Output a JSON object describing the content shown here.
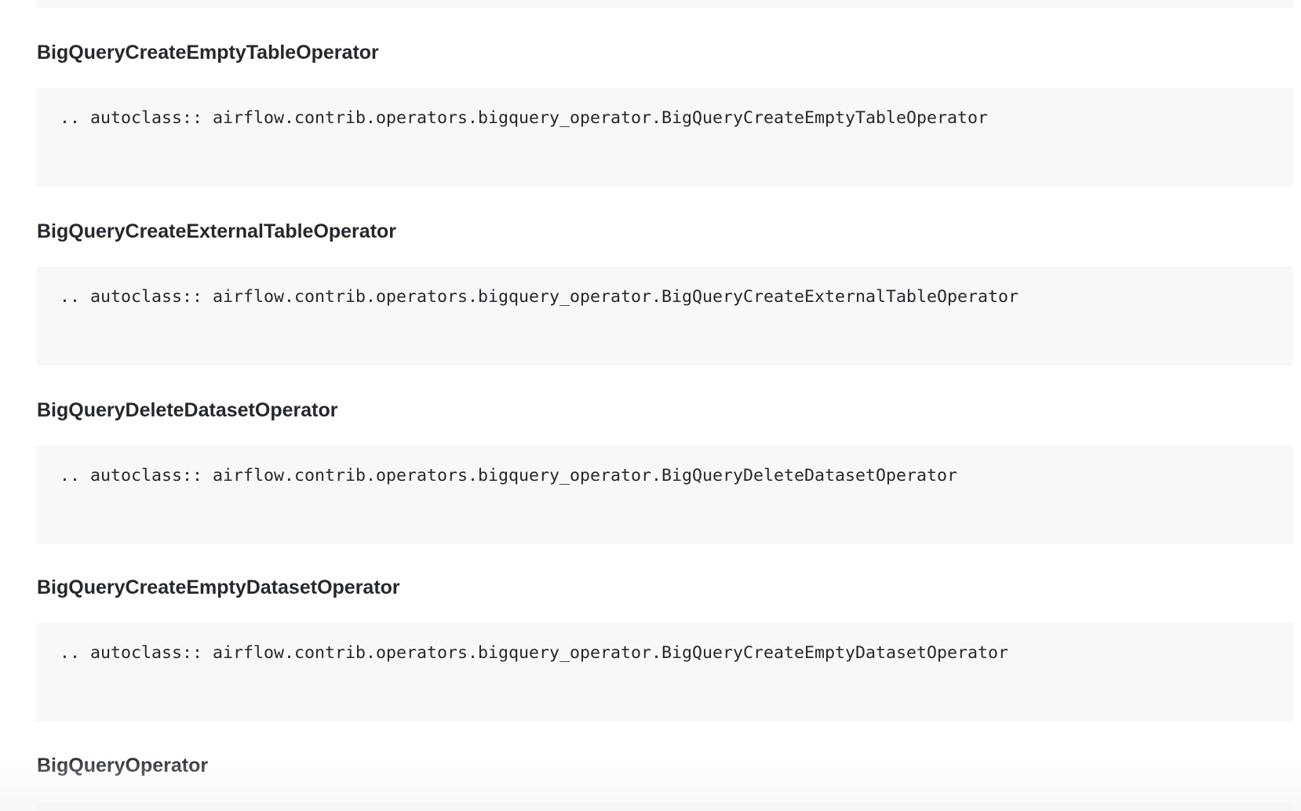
{
  "sections": [
    {
      "heading": "BigQueryCreateEmptyTableOperator",
      "code": ".. autoclass:: airflow.contrib.operators.bigquery_operator.BigQueryCreateEmptyTableOperator"
    },
    {
      "heading": "BigQueryCreateExternalTableOperator",
      "code": ".. autoclass:: airflow.contrib.operators.bigquery_operator.BigQueryCreateExternalTableOperator"
    },
    {
      "heading": "BigQueryDeleteDatasetOperator",
      "code": ".. autoclass:: airflow.contrib.operators.bigquery_operator.BigQueryDeleteDatasetOperator"
    },
    {
      "heading": "BigQueryCreateEmptyDatasetOperator",
      "code": ".. autoclass:: airflow.contrib.operators.bigquery_operator.BigQueryCreateEmptyDatasetOperator"
    }
  ],
  "last_heading": "BigQueryOperator"
}
